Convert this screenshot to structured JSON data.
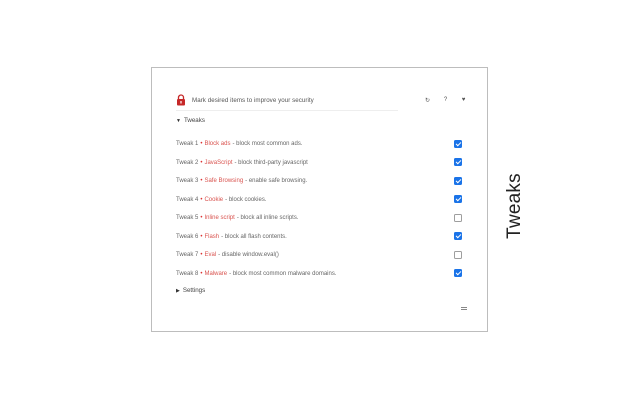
{
  "header": {
    "text": "Mark desired items to improve your security",
    "icons": [
      "lock-icon",
      "refresh-icon",
      "help-icon",
      "heart-icon"
    ],
    "refresh_glyph": "↻",
    "help_glyph": "?",
    "heart_glyph": "♥"
  },
  "sections": {
    "tweaks_label": "Tweaks",
    "tweaks_expanded": true,
    "settings_label": "Settings",
    "settings_expanded": false,
    "expanded_glyph": "▼",
    "collapsed_glyph": "▶"
  },
  "tweaks": [
    {
      "num": "Tweak 1",
      "name": "Block ads",
      "desc": "- block most common ads.",
      "checked": true
    },
    {
      "num": "Tweak 2",
      "name": "JavaScript",
      "desc": "- block third-party javascript",
      "checked": true
    },
    {
      "num": "Tweak 3",
      "name": "Safe Browsing",
      "desc": "- enable safe browsing.",
      "checked": true
    },
    {
      "num": "Tweak 4",
      "name": "Cookie",
      "desc": "- block cookies.",
      "checked": true
    },
    {
      "num": "Tweak 5",
      "name": "Inline script",
      "desc": "- block all inline scripts.",
      "checked": false
    },
    {
      "num": "Tweak 6",
      "name": "Flash",
      "desc": "- block all flash contents.",
      "checked": true
    },
    {
      "num": "Tweak 7",
      "name": "Eval",
      "desc": "- disable window.eval()",
      "checked": false
    },
    {
      "num": "Tweak 8",
      "name": "Malware",
      "desc": "- block most common malware domains.",
      "checked": true
    }
  ],
  "side_title": "Tweaks",
  "colors": {
    "accent": "#1a73e8",
    "tweak_name": "#d9534f",
    "lock": "#c62828"
  }
}
